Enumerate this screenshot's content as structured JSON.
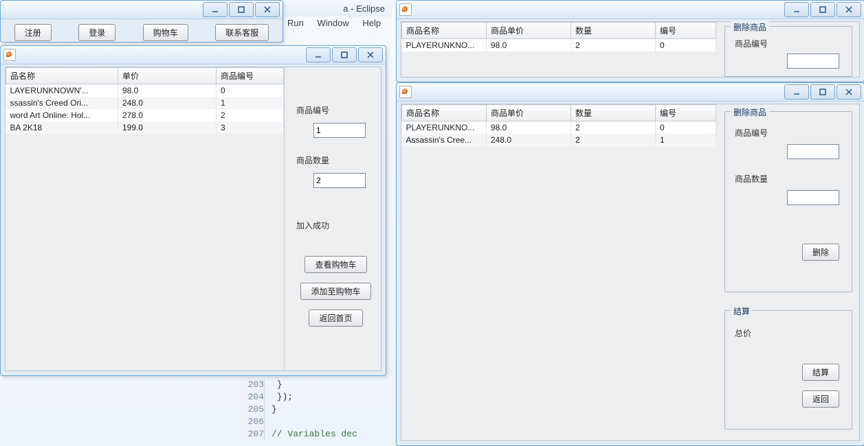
{
  "eclipse": {
    "title_fragment": "a - Eclipse",
    "menu": [
      "Run",
      "Window",
      "Help"
    ],
    "code_lines": [
      {
        "n": "203",
        "t": "        }"
      },
      {
        "n": "204",
        "t": "    });"
      },
      {
        "n": "205",
        "t": "}"
      },
      {
        "n": "206",
        "t": ""
      },
      {
        "n": "207",
        "t": "// Variables dec"
      }
    ]
  },
  "win_main": {
    "buttons": {
      "register": "注册",
      "login": "登录",
      "cart": "购物车",
      "contact": "联系客服"
    }
  },
  "win_products": {
    "headers": [
      "品名称",
      "单价",
      "商品编号"
    ],
    "rows": [
      {
        "name": "LAYERUNKNOWN'...",
        "price": "98.0",
        "id": "0"
      },
      {
        "name": "ssassin's Creed Ori...",
        "price": "248.0",
        "id": "1"
      },
      {
        "name": "word Art Online: Hol...",
        "price": "278.0",
        "id": "2"
      },
      {
        "name": "BA 2K18",
        "price": "199.0",
        "id": "3"
      }
    ],
    "side": {
      "id_label": "商品编号",
      "id_value": "1",
      "qty_label": "商品数量",
      "qty_value": "2",
      "status": "加入成功",
      "btn_view": "查看购物车",
      "btn_add": "添加至购物车",
      "btn_back": "返回首页"
    }
  },
  "win_cart1": {
    "headers": [
      "商品名称",
      "商品单价",
      "数量",
      "编号"
    ],
    "rows": [
      {
        "name": "PLAYERUNKNO...",
        "price": "98.0",
        "qty": "2",
        "id": "0"
      }
    ],
    "del_panel": {
      "title": "删除商品",
      "id_label": "商品编号"
    }
  },
  "win_cart2": {
    "headers": [
      "商品名称",
      "商品单价",
      "数量",
      "编号"
    ],
    "rows": [
      {
        "name": "PLAYERUNKNO...",
        "price": "98.0",
        "qty": "2",
        "id": "0"
      },
      {
        "name": "Assassin's Cree...",
        "price": "248.0",
        "qty": "2",
        "id": "1"
      }
    ],
    "del_panel": {
      "title": "删除商品",
      "id_label": "商品编号",
      "qty_label": "商品数量",
      "btn": "删除"
    },
    "checkout": {
      "title": "结算",
      "total_label": "总价",
      "btn_checkout": "结算",
      "btn_back": "返回"
    }
  }
}
